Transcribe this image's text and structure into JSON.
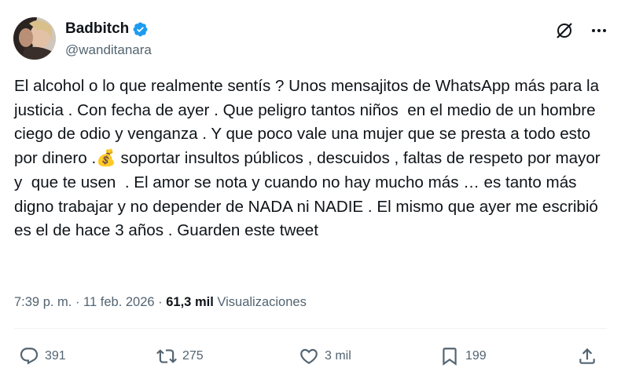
{
  "author": {
    "display_name": "Badbitch",
    "handle": "@wanditanara",
    "verified": true
  },
  "icons": {
    "verified": "verified-badge-icon",
    "grok": "grok-icon",
    "more": "more-icon",
    "reply": "reply-icon",
    "retweet": "retweet-icon",
    "like": "heart-icon",
    "bookmark": "bookmark-icon",
    "share": "share-icon"
  },
  "tweet": {
    "text": "El alcohol o lo que realmente sentís ? Unos mensajitos de WhatsApp más para la justicia . Con fecha de ayer . Que peligro tantos niños  en el medio de un hombre ciego de odio y venganza . Y que poco vale una mujer que se presta a todo esto por dinero .💰 soportar insultos públicos , descuidos , faltas de respeto por mayor y  que te usen  . El amor se nota y cuando no hay mucho más … es tanto más digno trabajar y no depender de NADA ni NADIE . El mismo que ayer me escribió es el de hace 3 años . Guarden este tweet",
    "time": "7:39 p. m.",
    "separator": " · ",
    "date": "11 feb. 2026",
    "views_count": "61,3 mil",
    "views_label": "Visualizaciones"
  },
  "actions": {
    "replies": "391",
    "retweets": "275",
    "likes": "3 mil",
    "bookmarks": "199"
  },
  "colors": {
    "text": "#0f1419",
    "secondary": "#536471",
    "verified": "#1d9bf0",
    "divider": "#eff3f4"
  }
}
